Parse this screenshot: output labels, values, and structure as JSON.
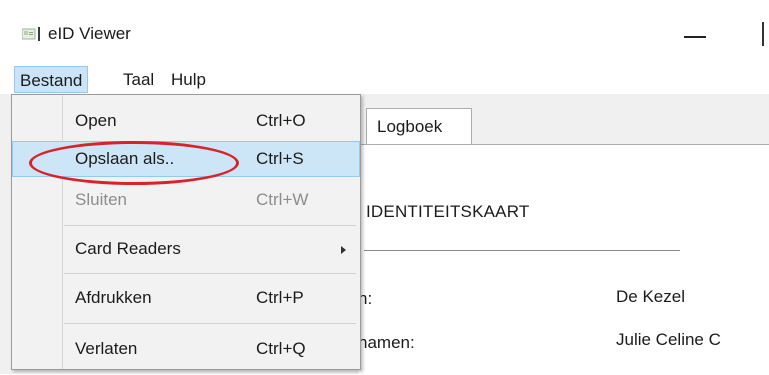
{
  "window": {
    "title": "eID Viewer",
    "icon": "eid-app-icon"
  },
  "menubar": {
    "items": [
      "Bestand",
      "Taal",
      "Hulp"
    ],
    "active": "Bestand"
  },
  "tabs": {
    "visible": [
      "Logboek"
    ]
  },
  "content": {
    "heading": "IDENTITEITSKAART",
    "fields": [
      {
        "label": "n:",
        "value": "De Kezel"
      },
      {
        "label": "namen:",
        "value": "Julie Celine C"
      }
    ]
  },
  "dropdown": {
    "items": [
      {
        "label": "Open",
        "shortcut": "Ctrl+O",
        "disabled": false
      },
      {
        "label": "Opslaan als..",
        "shortcut": "Ctrl+S",
        "disabled": false,
        "highlighted": true
      },
      {
        "label": "Sluiten",
        "shortcut": "Ctrl+W",
        "disabled": true
      },
      {
        "label": "Card Readers",
        "shortcut": "",
        "submenu": true
      },
      {
        "label": "Afdrukken",
        "shortcut": "Ctrl+P",
        "disabled": false
      },
      {
        "label": "Verlaten",
        "shortcut": "Ctrl+Q",
        "disabled": false
      }
    ]
  },
  "colors": {
    "highlight_bg": "#cde6f7",
    "highlight_border": "#91c9f7",
    "annotation": "#d9232b",
    "disabled_text": "#8d8d8d"
  }
}
